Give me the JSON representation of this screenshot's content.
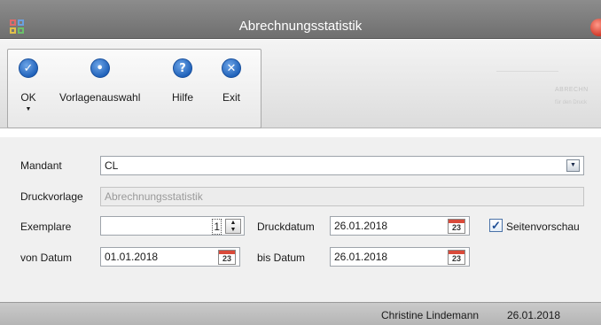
{
  "window": {
    "title": "Abrechnungsstatistik"
  },
  "toolbar": {
    "ok_label": "OK",
    "vorlagenauswahl_label": "Vorlagenauswahl",
    "hilfe_label": "Hilfe",
    "exit_label": "Exit",
    "ok_icon": "checkmark-icon",
    "vorlagenauswahl_icon": "template-select-icon",
    "hilfe_icon": "help-icon",
    "exit_icon": "close-x-icon"
  },
  "background_ghost": {
    "line1": "ABRECHN",
    "line2": "für den Druck"
  },
  "form": {
    "mandant_label": "Mandant",
    "mandant_value": "CL",
    "druckvorlage_label": "Druckvorlage",
    "druckvorlage_value": "Abrechnungsstatistik",
    "exemplare_label": "Exemplare",
    "exemplare_value": "1",
    "druckdatum_label": "Druckdatum",
    "druckdatum_value": "26.01.2018",
    "seitenvorschau_label": "Seitenvorschau",
    "seitenvorschau_checked": true,
    "von_datum_label": "von Datum",
    "von_datum_value": "01.01.2018",
    "bis_datum_label": "bis Datum",
    "bis_datum_value": "26.01.2018",
    "calendar_day": "23"
  },
  "status": {
    "user": "Christine Lindemann",
    "date": "26.01.2018"
  },
  "colors": {
    "accent": "#1d5fb8",
    "titlebar": "#7d7d7d",
    "close": "#d23a2a"
  }
}
